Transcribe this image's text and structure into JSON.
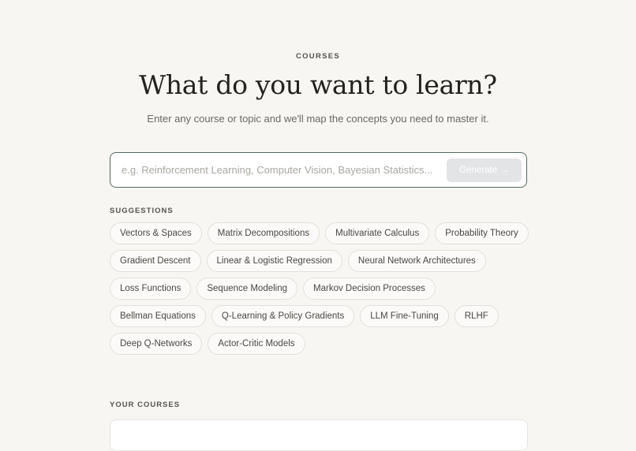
{
  "header": {
    "eyebrow": "COURSES",
    "title": "What do you want to learn?",
    "subtitle": "Enter any course or topic and we'll map the concepts you need to master it."
  },
  "search": {
    "placeholder": "e.g. Reinforcement Learning, Computer Vision, Bayesian Statistics...",
    "value": "",
    "button_label": "Generate →"
  },
  "suggestions": {
    "label": "SUGGESTIONS",
    "items": [
      "Vectors & Spaces",
      "Matrix Decompositions",
      "Multivariate Calculus",
      "Probability Theory",
      "Gradient Descent",
      "Linear & Logistic Regression",
      "Neural Network Architectures",
      "Loss Functions",
      "Sequence Modeling",
      "Markov Decision Processes",
      "Bellman Equations",
      "Q-Learning & Policy Gradients",
      "LLM Fine-Tuning",
      "RLHF",
      "Deep Q-Networks",
      "Actor-Critic Models"
    ]
  },
  "your_courses": {
    "label": "YOUR COURSES"
  },
  "colors": {
    "background": "#f7f6f2",
    "accent_border": "#546b60",
    "button_disabled": "#e3e4e6"
  }
}
